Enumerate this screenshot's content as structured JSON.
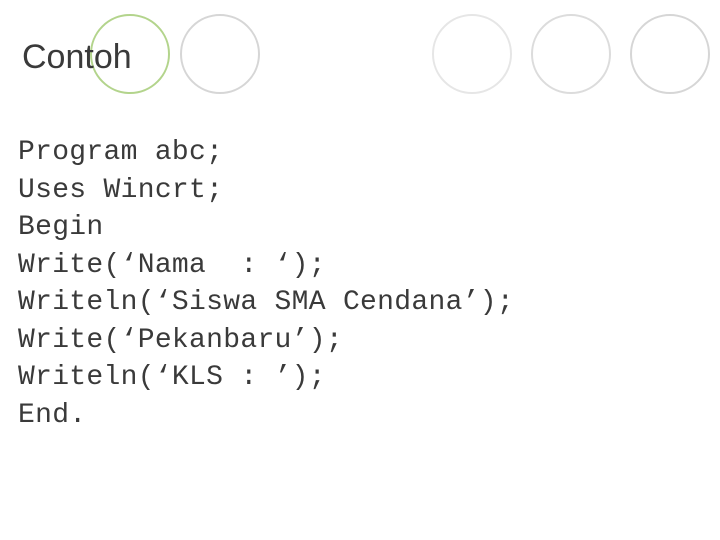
{
  "heading": "Contoh",
  "code": {
    "line1": "Program abc;",
    "line2": "Uses Wincrt;",
    "line3": "Begin",
    "line4": "Write(‘Nama  : ‘);",
    "line5": "Writeln(‘Siswa SMA Cendana’);",
    "line6": "Write(‘Pekanbaru’);",
    "line7": "Writeln(‘KLS : ’);",
    "line8": "End."
  }
}
